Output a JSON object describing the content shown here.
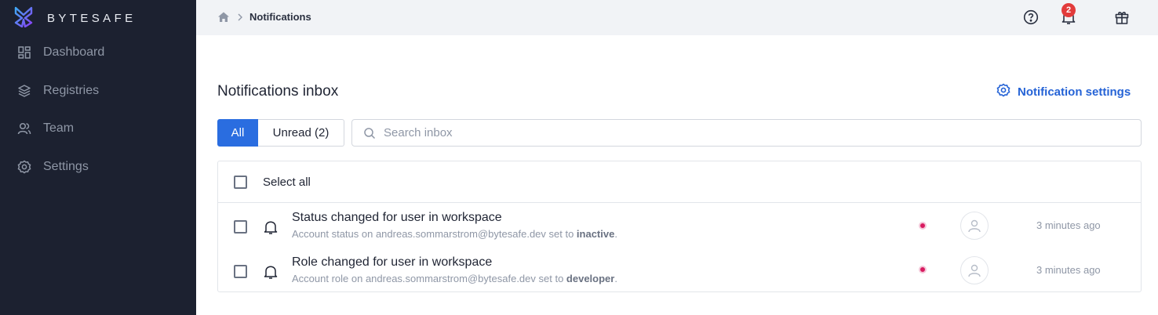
{
  "brand": {
    "name": "BYTESAFE",
    "logo_icon": "bytesafe-logo-icon"
  },
  "sidebar": {
    "items": [
      {
        "label": "Dashboard",
        "icon": "dashboard-icon"
      },
      {
        "label": "Registries",
        "icon": "layers-icon"
      },
      {
        "label": "Team",
        "icon": "users-icon"
      },
      {
        "label": "Settings",
        "icon": "gear-icon"
      }
    ]
  },
  "topbar": {
    "breadcrumb": {
      "home_icon": "home-icon",
      "current": "Notifications"
    },
    "help_icon": "help-icon",
    "bell_icon": "bell-icon",
    "notification_count": "2",
    "gift_icon": "gift-icon"
  },
  "main": {
    "title": "Notifications inbox",
    "settings_link": "Notification settings",
    "tabs": [
      {
        "label": "All",
        "active": true
      },
      {
        "label": "Unread (2)",
        "active": false
      }
    ],
    "search": {
      "placeholder": "Search inbox",
      "value": ""
    },
    "select_all": "Select all",
    "notifications": [
      {
        "title": "Status changed for user in workspace",
        "subtitle_prefix": "Account status on andreas.sommarstrom@bytesafe.dev set to ",
        "subtitle_value": "inactive",
        "subtitle_suffix": ".",
        "time": "3 minutes ago",
        "unread": true
      },
      {
        "title": "Role changed for user in workspace",
        "subtitle_prefix": "Account role on andreas.sommarstrom@bytesafe.dev set to ",
        "subtitle_value": "developer",
        "subtitle_suffix": ".",
        "time": "3 minutes ago",
        "unread": true
      }
    ]
  },
  "colors": {
    "sidebar_bg": "#1c2130",
    "accent": "#2a6de0",
    "link": "#2563d6",
    "unread_dot": "#d81b60",
    "badge": "#e23b3b"
  }
}
